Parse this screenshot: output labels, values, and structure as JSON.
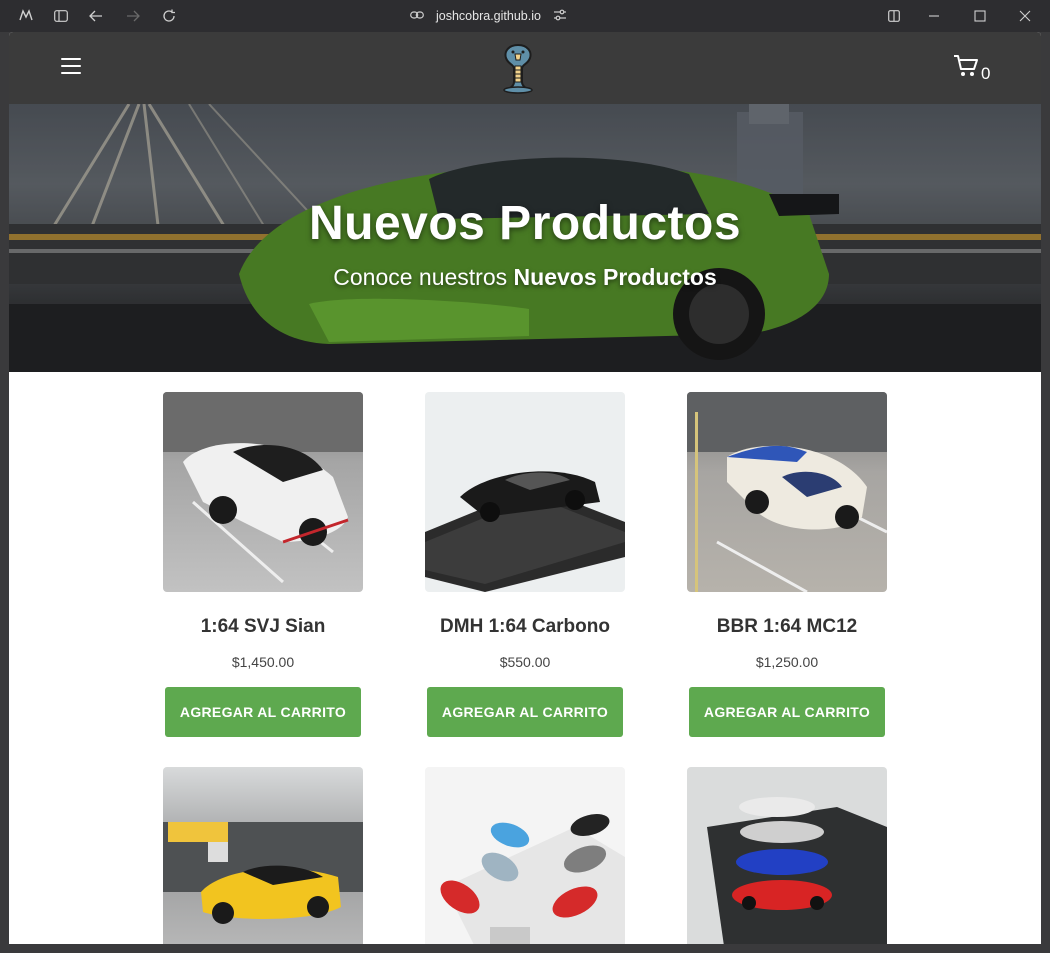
{
  "browser": {
    "url": "joshcobra.github.io"
  },
  "navbar": {
    "menu_icon": "hamburger-icon",
    "logo_icon": "cobra-logo",
    "cart_icon": "cart-icon",
    "cart_count": "0"
  },
  "hero": {
    "title": "Nuevos Productos",
    "subtitle_prefix": "Conoce nuestros ",
    "subtitle_bold": "Nuevos Productos"
  },
  "products": [
    {
      "name": "1:64 SVJ Sian",
      "price": "$1,450.00",
      "button": "AGREGAR AL CARRITO"
    },
    {
      "name": "DMH 1:64 Carbono",
      "price": "$550.00",
      "button": "AGREGAR AL CARRITO"
    },
    {
      "name": "BBR 1:64 MC12",
      "price": "$1,250.00",
      "button": "AGREGAR AL CARRITO"
    },
    {
      "name": "",
      "price": "",
      "button": ""
    },
    {
      "name": "",
      "price": "",
      "button": ""
    },
    {
      "name": "",
      "price": "",
      "button": ""
    }
  ],
  "colors": {
    "navbar_bg": "#3b3b3b",
    "button_bg": "#5ea94f",
    "text": "#333333"
  }
}
